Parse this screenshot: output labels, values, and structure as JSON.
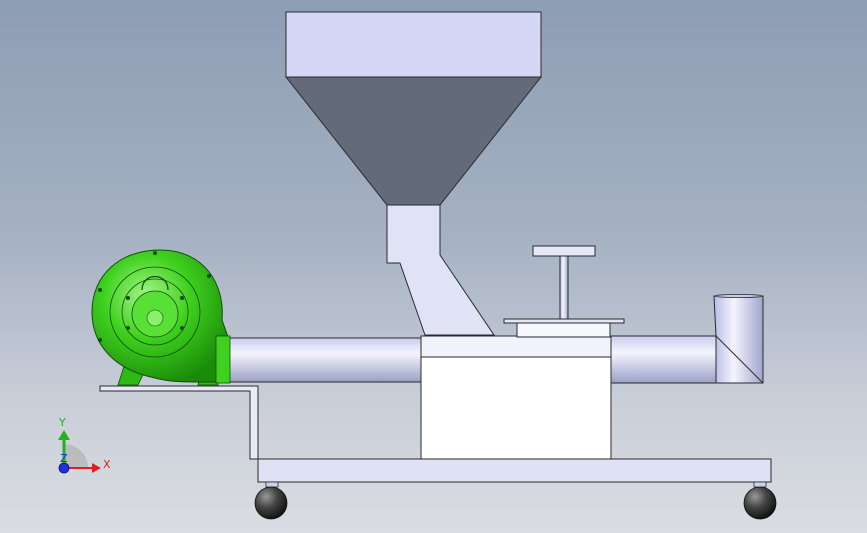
{
  "viewport": {
    "background_top": "#8d9db4",
    "background_bottom": "#dadde2"
  },
  "colors": {
    "hopper_top": "#d4d8f4",
    "hopper_funnel": "#636a7a",
    "pipe_light": "#eef0fb",
    "pipe_dark": "#9aa0c6",
    "body_fill": "#ffffff",
    "blower_green": "#33cc1a",
    "blower_dark": "#1e8a0c",
    "frame_fill": "#dfe2f5",
    "wheel": "#3a3a3a"
  },
  "triad": {
    "x_label": "X",
    "y_label": "Y",
    "z_label": "Z",
    "x_color": "#e02020",
    "y_color": "#20b020",
    "z_color": "#2030e0"
  },
  "parts": [
    "hopper-box-icon",
    "hopper-funnel-icon",
    "chute-icon",
    "blower-icon",
    "conveyor-pipe-icon",
    "mixing-box-icon",
    "handle-icon",
    "outlet-elbow-icon",
    "base-frame-icon",
    "caster-wheel-icon"
  ]
}
